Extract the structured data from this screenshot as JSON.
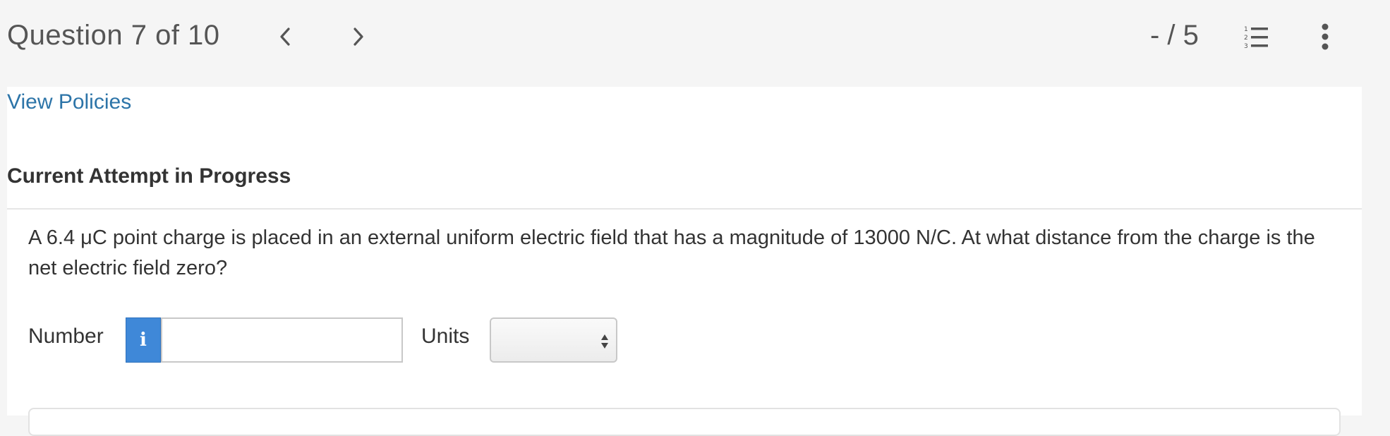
{
  "header": {
    "question_counter": "Question 7 of 10",
    "score": "- / 5",
    "prev_icon": "chevron-left-icon",
    "next_icon": "chevron-right-icon",
    "list_icon": "numbered-list-icon",
    "menu_icon": "vertical-ellipsis-icon"
  },
  "links": {
    "view_policies": "View Policies"
  },
  "section": {
    "title": "Current Attempt in Progress"
  },
  "question": {
    "text": "A 6.4 μC point charge is placed in an external uniform electric field that has a magnitude of 13000 N/C. At what distance from the charge is the net electric field zero?"
  },
  "answer": {
    "number_label": "Number",
    "info_glyph": "i",
    "number_value": "",
    "units_label": "Units",
    "units_selected": ""
  },
  "colors": {
    "link": "#2c74a8",
    "info_button": "#3f88d8",
    "header_bg": "#f5f5f5"
  }
}
